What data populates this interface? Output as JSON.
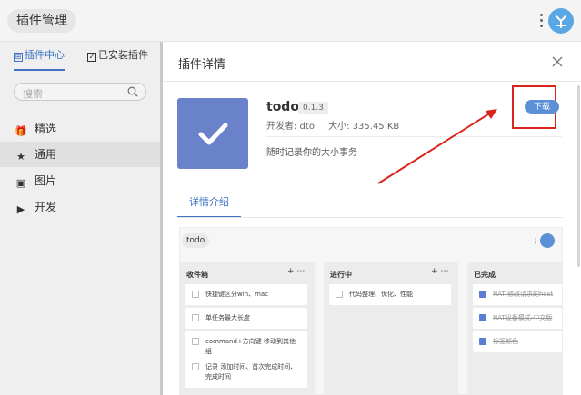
{
  "app": {
    "title": "插件管理"
  },
  "colors": {
    "accent": "#3f74c5",
    "download": "#5b8fd6",
    "logo_bg": "#6a82c9",
    "annotation": "#d9241c"
  },
  "sidebar": {
    "tabs": [
      {
        "label": "插件中心",
        "icon": "store-icon",
        "active": true
      },
      {
        "label": "已安装插件",
        "icon": "checkbox-icon",
        "active": false
      }
    ],
    "search": {
      "placeholder": "搜索",
      "icon": "search-icon"
    },
    "items": [
      {
        "label": "精选",
        "icon": "gift-icon",
        "active": false
      },
      {
        "label": "通用",
        "icon": "star-icon",
        "active": true
      },
      {
        "label": "图片",
        "icon": "image-icon",
        "active": false
      },
      {
        "label": "开发",
        "icon": "terminal-icon",
        "active": false
      }
    ]
  },
  "panel": {
    "title": "插件详情",
    "plugin": {
      "name": "todo",
      "version": "0.1.3",
      "developer": "开发者: dto",
      "size": "大小: 335.45 KB",
      "description": "随时记录你的大小事务",
      "download_label": "下载"
    },
    "tabs": [
      {
        "label": "详情介绍",
        "active": true
      }
    ],
    "preview": {
      "title": "todo",
      "columns": [
        {
          "title": "收件箱",
          "cards": [
            {
              "text": "快捷键区分win、mac",
              "done": false
            },
            {
              "text": "单任务最大长度",
              "done": false
            },
            {
              "text": "command+方向键 移动到其他组",
              "done": false
            },
            {
              "text": "记录 添加时间、首次完成时间、完成时间",
              "done": false
            }
          ]
        },
        {
          "title": "进行中",
          "cards": [
            {
              "text": "代码整理、优化、性能",
              "done": false
            }
          ]
        },
        {
          "title": "已完成",
          "cards": [
            {
              "text": "NAT 修改请求的host",
              "done": true
            },
            {
              "text": "NAT设备模式-中文版",
              "done": true
            },
            {
              "text": "标签颜色",
              "done": true
            }
          ]
        }
      ]
    }
  }
}
